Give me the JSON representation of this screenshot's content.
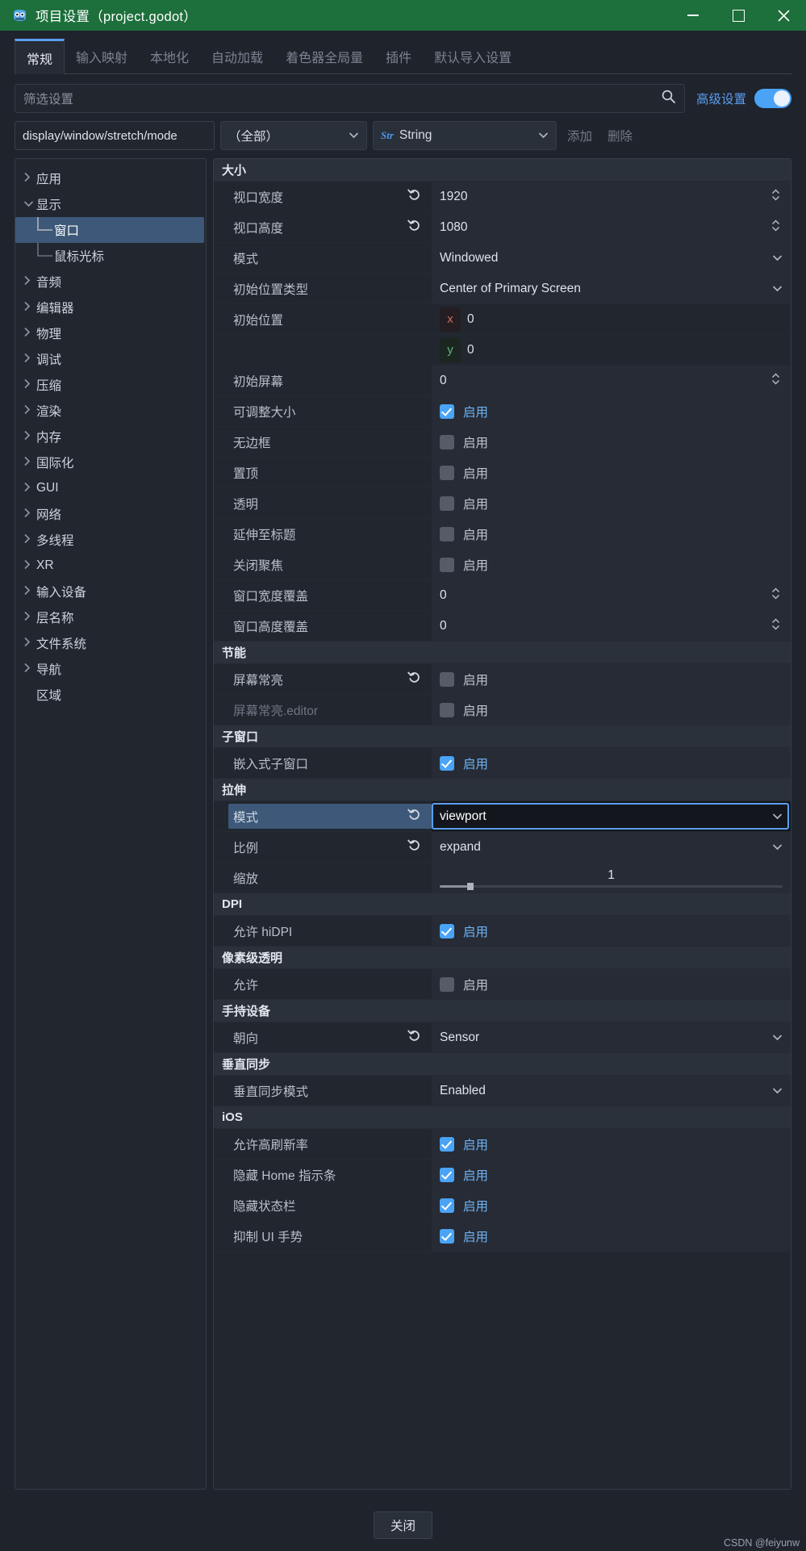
{
  "window": {
    "title": "项目设置（project.godot）",
    "logo_icon": "godot-robot-icon",
    "minimize_icon": "minimize-icon",
    "maximize_icon": "maximize-icon",
    "close_icon": "close-icon",
    "titlebar_color": "#1d6f3b"
  },
  "tabs": [
    {
      "label": "常规",
      "active": true
    },
    {
      "label": "输入映射",
      "active": false
    },
    {
      "label": "本地化",
      "active": false
    },
    {
      "label": "自动加载",
      "active": false
    },
    {
      "label": "着色器全局量",
      "active": false
    },
    {
      "label": "插件",
      "active": false
    },
    {
      "label": "默认导入设置",
      "active": false
    }
  ],
  "filter": {
    "placeholder": "筛选设置",
    "value": "",
    "search_icon": "search-icon",
    "advanced_label": "高级设置",
    "advanced_on": true,
    "accent_color": "#4aa3f5"
  },
  "path_row": {
    "property_path": "display/window/stretch/mode",
    "scope_value": "（全部）",
    "type_value": "String",
    "type_icon": "string-type-icon",
    "add_label": "添加",
    "delete_label": "删除"
  },
  "sidebar": [
    {
      "label": "应用",
      "state": "collapsed",
      "depth": 0,
      "selected": false
    },
    {
      "label": "显示",
      "state": "expanded",
      "depth": 0,
      "selected": false
    },
    {
      "label": "窗口",
      "state": "leaf",
      "depth": 1,
      "selected": true
    },
    {
      "label": "鼠标光标",
      "state": "leaf",
      "depth": 1,
      "selected": false
    },
    {
      "label": "音频",
      "state": "collapsed",
      "depth": 0,
      "selected": false
    },
    {
      "label": "编辑器",
      "state": "collapsed",
      "depth": 0,
      "selected": false
    },
    {
      "label": "物理",
      "state": "collapsed",
      "depth": 0,
      "selected": false
    },
    {
      "label": "调试",
      "state": "collapsed",
      "depth": 0,
      "selected": false
    },
    {
      "label": "压缩",
      "state": "collapsed",
      "depth": 0,
      "selected": false
    },
    {
      "label": "渲染",
      "state": "collapsed",
      "depth": 0,
      "selected": false
    },
    {
      "label": "内存",
      "state": "collapsed",
      "depth": 0,
      "selected": false
    },
    {
      "label": "国际化",
      "state": "collapsed",
      "depth": 0,
      "selected": false
    },
    {
      "label": "GUI",
      "state": "collapsed",
      "depth": 0,
      "selected": false
    },
    {
      "label": "网络",
      "state": "collapsed",
      "depth": 0,
      "selected": false
    },
    {
      "label": "多线程",
      "state": "collapsed",
      "depth": 0,
      "selected": false
    },
    {
      "label": "XR",
      "state": "collapsed",
      "depth": 0,
      "selected": false
    },
    {
      "label": "输入设备",
      "state": "collapsed",
      "depth": 0,
      "selected": false
    },
    {
      "label": "层名称",
      "state": "collapsed",
      "depth": 0,
      "selected": false
    },
    {
      "label": "文件系统",
      "state": "collapsed",
      "depth": 0,
      "selected": false
    },
    {
      "label": "导航",
      "state": "collapsed",
      "depth": 0,
      "selected": false
    },
    {
      "label": "区域",
      "state": "none",
      "depth": 0,
      "selected": false
    }
  ],
  "properties": {
    "sections": [
      {
        "title": "大小",
        "rows": [
          {
            "name": "视口宽度",
            "kind": "number",
            "value": "1920",
            "revert": true,
            "spinner": true
          },
          {
            "name": "视口高度",
            "kind": "number",
            "value": "1080",
            "revert": true,
            "spinner": true
          },
          {
            "name": "模式",
            "kind": "enum",
            "value": "Windowed",
            "revert": false
          },
          {
            "name": "初始位置类型",
            "kind": "enum",
            "value": "Center of Primary Screen",
            "revert": false
          },
          {
            "name": "初始位置",
            "kind": "vector_x",
            "value": "0",
            "axis": "x",
            "revert": false
          },
          {
            "name": "",
            "kind": "vector_y",
            "value": "0",
            "axis": "y",
            "revert": false
          },
          {
            "name": "初始屏幕",
            "kind": "number",
            "value": "0",
            "revert": false,
            "spinner": true
          },
          {
            "name": "可调整大小",
            "kind": "check",
            "value": "启用",
            "checked": true
          },
          {
            "name": "无边框",
            "kind": "check",
            "value": "启用",
            "checked": false
          },
          {
            "name": "置顶",
            "kind": "check",
            "value": "启用",
            "checked": false
          },
          {
            "name": "透明",
            "kind": "check",
            "value": "启用",
            "checked": false
          },
          {
            "name": "延伸至标题",
            "kind": "check",
            "value": "启用",
            "checked": false
          },
          {
            "name": "关闭聚焦",
            "kind": "check",
            "value": "启用",
            "checked": false
          },
          {
            "name": "窗口宽度覆盖",
            "kind": "number",
            "value": "0",
            "spinner": true
          },
          {
            "name": "窗口高度覆盖",
            "kind": "number",
            "value": "0",
            "spinner": true
          }
        ]
      },
      {
        "title": "节能",
        "rows": [
          {
            "name": "屏幕常亮",
            "kind": "check",
            "value": "启用",
            "checked": false,
            "revert": true
          },
          {
            "name": "屏幕常亮.editor",
            "kind": "check",
            "value": "启用",
            "checked": false,
            "dim": true
          }
        ]
      },
      {
        "title": "子窗口",
        "rows": [
          {
            "name": "嵌入式子窗口",
            "kind": "check",
            "value": "启用",
            "checked": true
          }
        ]
      },
      {
        "title": "拉伸",
        "rows": [
          {
            "name": "模式",
            "kind": "enum",
            "value": "viewport",
            "revert": true,
            "highlighted": true,
            "focused": true
          },
          {
            "name": "比例",
            "kind": "enum",
            "value": "expand",
            "revert": true
          },
          {
            "name": "缩放",
            "kind": "slider",
            "value": "1",
            "min": 0,
            "max": 10,
            "fraction": 0.08
          }
        ]
      },
      {
        "title": "DPI",
        "rows": [
          {
            "name": "允许 hiDPI",
            "kind": "check",
            "value": "启用",
            "checked": true
          }
        ]
      },
      {
        "title": "像素级透明",
        "rows": [
          {
            "name": "允许",
            "kind": "check",
            "value": "启用",
            "checked": false
          }
        ]
      },
      {
        "title": "手持设备",
        "rows": [
          {
            "name": "朝向",
            "kind": "enum",
            "value": "Sensor",
            "revert": true
          }
        ]
      },
      {
        "title": "垂直同步",
        "rows": [
          {
            "name": "垂直同步模式",
            "kind": "enum",
            "value": "Enabled",
            "revert": false
          }
        ]
      },
      {
        "title": "iOS",
        "rows": [
          {
            "name": "允许高刷新率",
            "kind": "check",
            "value": "启用",
            "checked": true
          },
          {
            "name": "隐藏 Home 指示条",
            "kind": "check",
            "value": "启用",
            "checked": true
          },
          {
            "name": "隐藏状态栏",
            "kind": "check",
            "value": "启用",
            "checked": true
          },
          {
            "name": "抑制 UI 手势",
            "kind": "check",
            "value": "启用",
            "checked": true
          }
        ]
      }
    ]
  },
  "footer": {
    "close_label": "关闭",
    "watermark": "CSDN @feiyunw"
  }
}
